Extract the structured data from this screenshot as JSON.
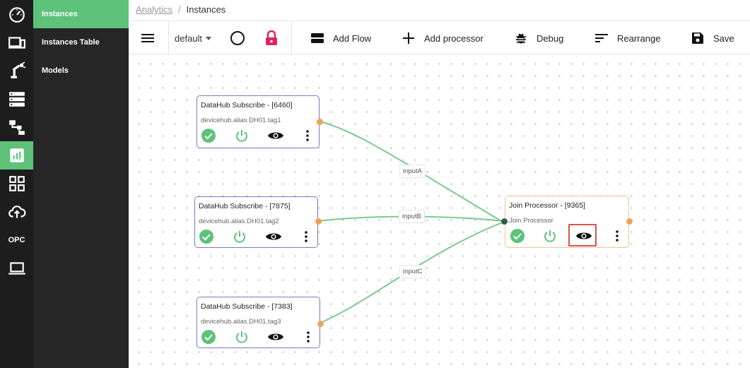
{
  "rail": {
    "items": [
      {
        "icon": "speedometer-icon"
      },
      {
        "icon": "devices-icon"
      },
      {
        "icon": "robot-arm-icon"
      },
      {
        "icon": "server-icon"
      },
      {
        "icon": "hierarchy-icon"
      },
      {
        "icon": "analytics-icon",
        "active": true
      },
      {
        "icon": "apps-grid-icon"
      },
      {
        "icon": "cloud-upload-icon"
      },
      {
        "label": "OPC"
      },
      {
        "icon": "laptop-icon"
      }
    ],
    "opc_label": "OPC"
  },
  "submenu": {
    "items": [
      {
        "label": "Instances",
        "active": true
      },
      {
        "label": "Instances Table"
      },
      {
        "label": "Models"
      }
    ]
  },
  "breadcrumb": {
    "root": "Analytics",
    "separator": "/",
    "current": "Instances"
  },
  "toolbar": {
    "select_value": "default",
    "add_flow": "Add Flow",
    "add_processor": "Add processor",
    "debug": "Debug",
    "rearrange": "Rearrange",
    "save": "Save"
  },
  "nodes": [
    {
      "id": "n1",
      "title": "DataHub Subscribe - [6460]",
      "subtitle": "devicehub.alias.DH01.tag1"
    },
    {
      "id": "n2",
      "title": "DataHub Subscribe - [7875]",
      "subtitle": "devicehub.alias.DH01.tag2"
    },
    {
      "id": "n3",
      "title": "DataHub Subscribe - [7383]",
      "subtitle": "devicehub.alias.DH01.tag3"
    },
    {
      "id": "n4",
      "title": "Join Processor - [9365]",
      "subtitle": "Join Processor"
    }
  ],
  "edges": [
    {
      "label": "inputA"
    },
    {
      "label": "inputB"
    },
    {
      "label": "inputC"
    }
  ],
  "colors": {
    "accent_green": "#5ec27a",
    "port_orange": "#f1a253",
    "lock_red": "#e0245e",
    "highlight_red": "#d9534f",
    "node_border_blue": "#7b78c9",
    "node_border_orange": "#f0c78d"
  }
}
